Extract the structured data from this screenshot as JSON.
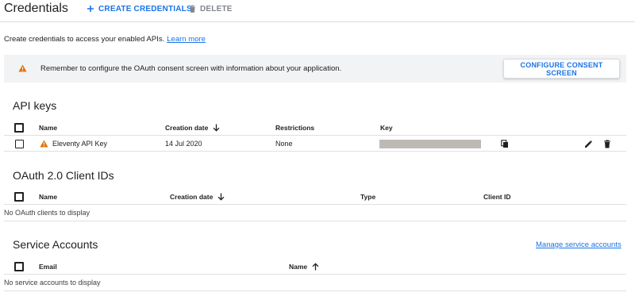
{
  "header": {
    "title": "Credentials",
    "create_label": "CREATE CREDENTIALS",
    "delete_label": "DELETE"
  },
  "intro": {
    "text": "Create credentials to access your enabled APIs.",
    "link": "Learn more"
  },
  "banner": {
    "message": "Remember to configure the OAuth consent screen with information about your application.",
    "button": "CONFIGURE CONSENT SCREEN"
  },
  "api_keys": {
    "title": "API keys",
    "columns": {
      "name": "Name",
      "creation_date": "Creation date",
      "restrictions": "Restrictions",
      "key": "Key"
    },
    "rows": [
      {
        "name": "Eleventy API Key",
        "creation_date": "14 Jul 2020",
        "restrictions": "None"
      }
    ]
  },
  "oauth": {
    "title": "OAuth 2.0 Client IDs",
    "columns": {
      "name": "Name",
      "creation_date": "Creation date",
      "type": "Type",
      "client_id": "Client ID"
    },
    "empty": "No OAuth clients to display"
  },
  "service_accounts": {
    "title": "Service Accounts",
    "manage_link": "Manage service accounts",
    "columns": {
      "email": "Email",
      "name": "Name"
    },
    "empty": "No service accounts to display"
  },
  "colors": {
    "accent": "#1a73e8",
    "warning": "#e37400",
    "divider": "#dadce0",
    "banner_bg": "#f1f3f4"
  }
}
